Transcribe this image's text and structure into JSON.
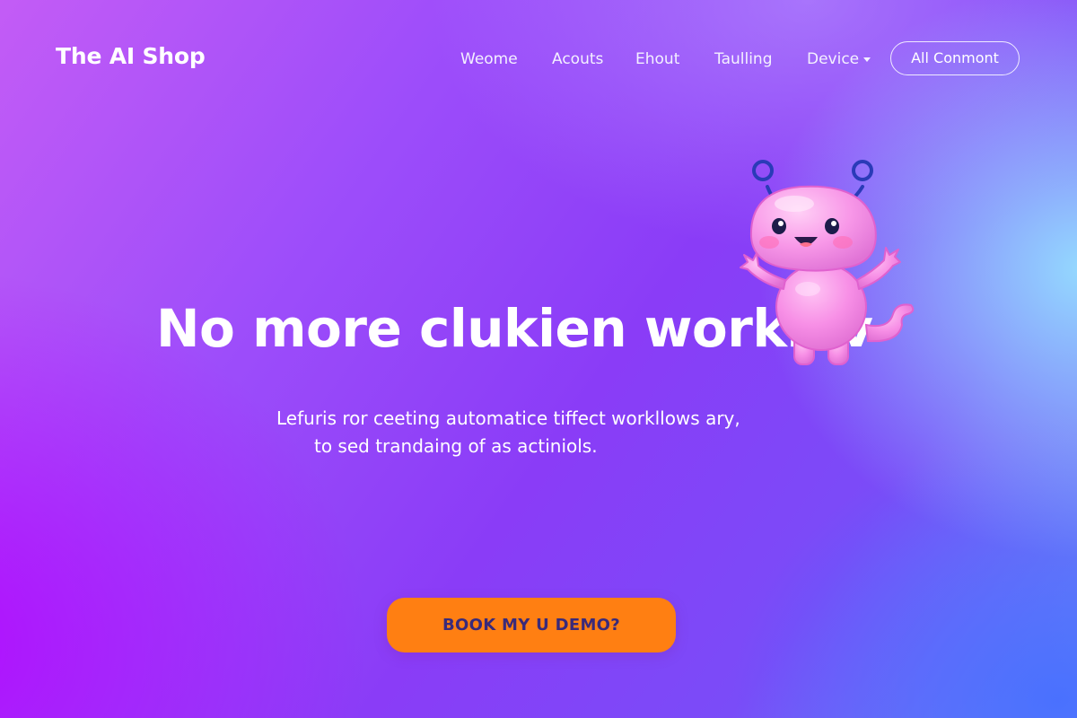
{
  "brand": {
    "name": "The AI Shop"
  },
  "nav": {
    "items": [
      {
        "label": "Weome"
      },
      {
        "label": "Acouts"
      },
      {
        "label": "Ehout"
      },
      {
        "label": "Taulling"
      },
      {
        "label": "Device"
      }
    ],
    "cta_label": "All Conmont"
  },
  "hero": {
    "title": "No more clukien worklov",
    "subtitle_line1": "Lefuris ror ceeting automatice tiffect workllows ary,",
    "subtitle_line2": "to sed trandaing of as actiniols.",
    "cta_label": "BOOK MY U DEMO?"
  },
  "icons": {
    "mascot": "pink-robot-mascot-icon",
    "dropdown": "chevron-down-icon"
  },
  "colors": {
    "cta_background": "#ff7f12",
    "cta_text": "#3a2a7a",
    "mascot_body": "#f78fe6",
    "mascot_antenna": "#2a3bb8"
  }
}
